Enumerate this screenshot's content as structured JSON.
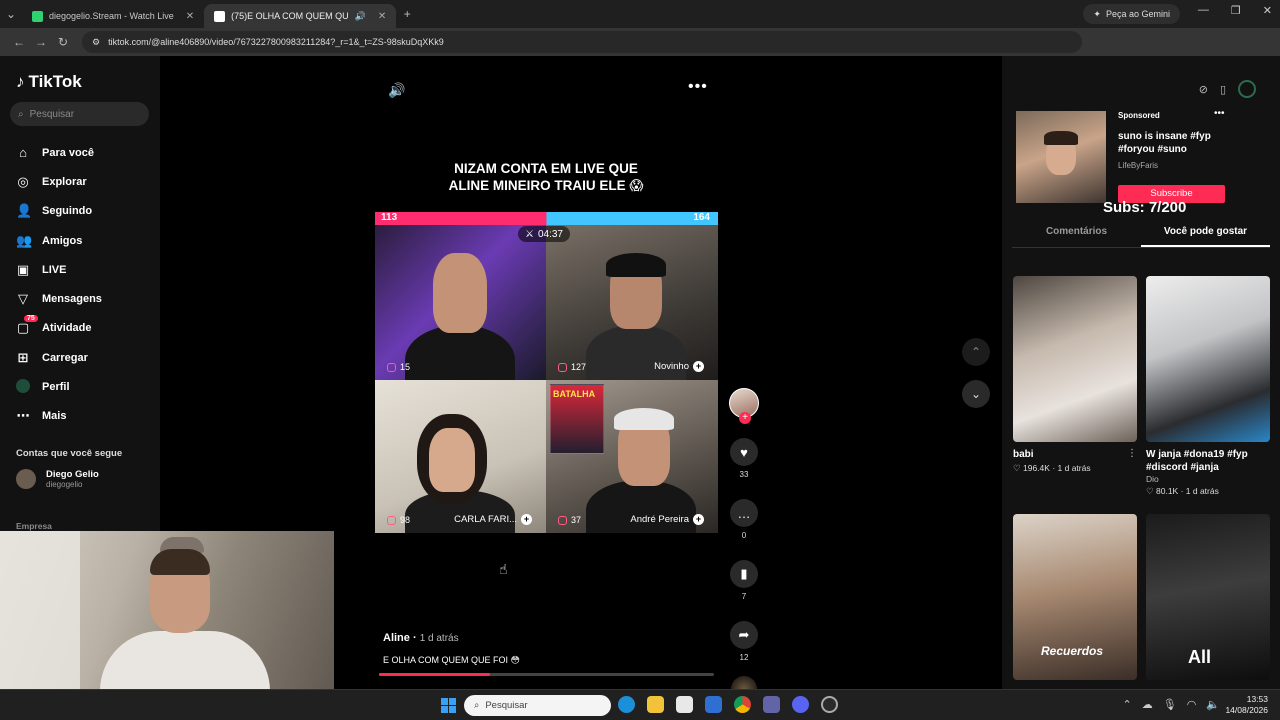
{
  "browser": {
    "tabs": [
      {
        "title": "diegogelio.Stream - Watch Live",
        "favicon_color": "#2fd26e"
      },
      {
        "title": "(75)E OLHA COM QUEM QU",
        "favicon_color": "#ffffff"
      }
    ],
    "url": "tiktok.com/@aline406890/video/7673227800983211284?_r=1&_t=ZS-98skuDqXKk9",
    "gemini_label": "Peça ao Gemini"
  },
  "sidebar": {
    "logo": "TikTok",
    "search_placeholder": "Pesquisar",
    "items": [
      {
        "label": "Para você",
        "icon": "home-icon"
      },
      {
        "label": "Explorar",
        "icon": "compass-icon"
      },
      {
        "label": "Seguindo",
        "icon": "following-icon"
      },
      {
        "label": "Amigos",
        "icon": "friends-icon"
      },
      {
        "label": "LIVE",
        "icon": "live-icon"
      },
      {
        "label": "Mensagens",
        "icon": "messages-icon"
      },
      {
        "label": "Atividade",
        "icon": "activity-icon",
        "badge": "75"
      },
      {
        "label": "Carregar",
        "icon": "upload-icon"
      },
      {
        "label": "Perfil",
        "icon": "profile-icon"
      },
      {
        "label": "Mais",
        "icon": "more-icon"
      }
    ],
    "following_title": "Contas que você segue",
    "following": {
      "name": "Diego Gelio",
      "handle": "diegogelio"
    },
    "empresa": "Empresa"
  },
  "video": {
    "title_line1": "NIZAM CONTA EM LIVE QUE",
    "title_line2": "ALINE MINEIRO TRAIU ELE 😱",
    "score_left": "113",
    "score_right": "164",
    "timer": "04:37",
    "cells": [
      {
        "viewers": "15",
        "name": ""
      },
      {
        "viewers": "127",
        "name": "Novinho"
      },
      {
        "viewers": "98",
        "name": "CARLA FARI..."
      },
      {
        "viewers": "37",
        "name": "André Pereira"
      }
    ],
    "poster_text": "BATALHA",
    "author": "Aline",
    "posted": "1 d atrás",
    "description": "E OLHA COM QUEM QUE FOI 😳",
    "progress": 0.33,
    "likes": "33",
    "comments": "0",
    "saves": "7",
    "shares": "12"
  },
  "right_panel": {
    "sponsored": "Sponsored",
    "ad_title": "suno is insane #fyp #foryou #suno",
    "ad_author": "LifeByFaris",
    "subscribe_label": "Subscribe",
    "subs_overlay": "Subs: 7/200",
    "tabs": [
      "Comentários",
      "Você pode gostar"
    ],
    "videos": [
      {
        "caption": "babi",
        "views": "196.4K",
        "age": "1 d atrás",
        "user": ""
      },
      {
        "caption": "W janja #dona19 #fyp #discord #janja",
        "views": "80.1K",
        "age": "1 d atrás",
        "user": "Dio"
      },
      {
        "caption": "",
        "views": "",
        "age": "",
        "user": "",
        "overlay": "Recuerdos"
      },
      {
        "caption": "",
        "views": "",
        "age": "",
        "user": "",
        "overlay": "All"
      }
    ]
  },
  "taskbar": {
    "search_placeholder": "Pesquisar",
    "time": "13:53",
    "date": "14/08/2026"
  }
}
